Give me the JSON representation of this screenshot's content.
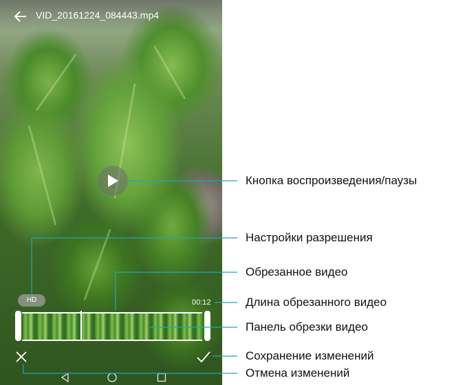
{
  "screen": {
    "title": "VID_20161224_084443.mp4",
    "hd_label": "HD",
    "trim_duration": "00:12"
  },
  "icons": {
    "back": "arrow-left-icon",
    "play": "play-icon",
    "cancel": "close-icon",
    "save": "check-icon",
    "nav_back": "triangle-back-icon",
    "nav_home": "circle-home-icon",
    "nav_recent": "square-recent-icon"
  },
  "callouts": [
    {
      "id": "play_pause",
      "text": "Кнопка воспроизведения/паузы"
    },
    {
      "id": "resolution",
      "text": "Настройки разрешения"
    },
    {
      "id": "trimmed_video",
      "text": "Обрезанное видео"
    },
    {
      "id": "trimmed_length",
      "text": "Длина обрезанного видео"
    },
    {
      "id": "trim_panel",
      "text": "Панель обрезки видео"
    },
    {
      "id": "save_changes",
      "text": "Сохранение изменений"
    },
    {
      "id": "cancel_changes",
      "text": "Отмена изменений"
    }
  ],
  "colors": {
    "callout_line": "#1fa7b8",
    "label_text": "#111111"
  }
}
